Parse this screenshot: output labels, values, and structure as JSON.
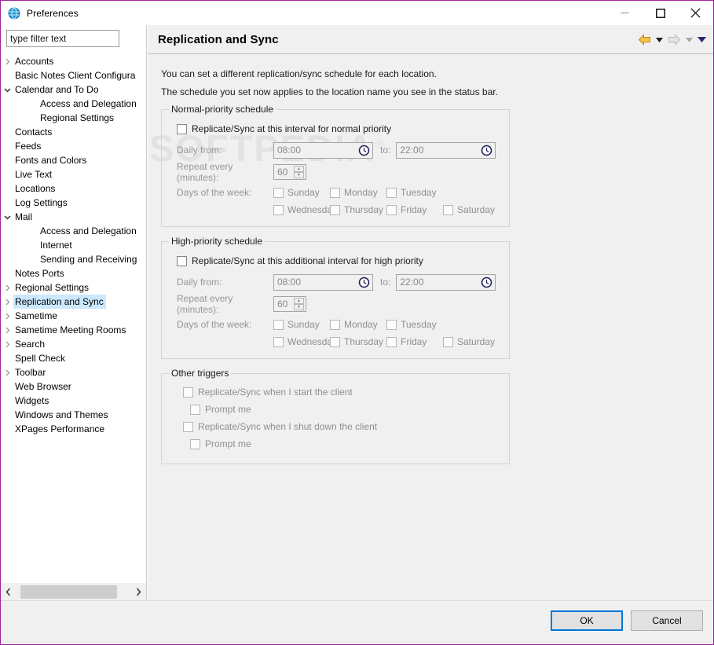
{
  "window": {
    "title": "Preferences",
    "icon": "notes-globe-icon",
    "border_color": "#a0249a",
    "minimize_label": "Minimize",
    "maximize_label": "Maximize",
    "close_label": "Close"
  },
  "watermark": {
    "text": "SOFTPEDIA",
    "mark": "®"
  },
  "sidebar": {
    "filter": {
      "value": "type filter text",
      "placeholder": "type filter text"
    },
    "items": [
      {
        "label": "Accounts",
        "level": 0,
        "arrow": "collapsed",
        "selected": false
      },
      {
        "label": "Basic Notes Client Configura",
        "level": 0,
        "arrow": "none",
        "selected": false
      },
      {
        "label": "Calendar and To Do",
        "level": 0,
        "arrow": "expanded",
        "selected": false
      },
      {
        "label": "Access and Delegation",
        "level": 1,
        "arrow": "none",
        "selected": false
      },
      {
        "label": "Regional Settings",
        "level": 1,
        "arrow": "none",
        "selected": false
      },
      {
        "label": "Contacts",
        "level": 0,
        "arrow": "none",
        "selected": false
      },
      {
        "label": "Feeds",
        "level": 0,
        "arrow": "none",
        "selected": false
      },
      {
        "label": "Fonts and Colors",
        "level": 0,
        "arrow": "none",
        "selected": false
      },
      {
        "label": "Live Text",
        "level": 0,
        "arrow": "none",
        "selected": false
      },
      {
        "label": "Locations",
        "level": 0,
        "arrow": "none",
        "selected": false
      },
      {
        "label": "Log Settings",
        "level": 0,
        "arrow": "none",
        "selected": false
      },
      {
        "label": "Mail",
        "level": 0,
        "arrow": "expanded",
        "selected": false
      },
      {
        "label": "Access and Delegation",
        "level": 1,
        "arrow": "none",
        "selected": false
      },
      {
        "label": "Internet",
        "level": 1,
        "arrow": "none",
        "selected": false
      },
      {
        "label": "Sending and Receiving",
        "level": 1,
        "arrow": "none",
        "selected": false
      },
      {
        "label": "Notes Ports",
        "level": 0,
        "arrow": "none",
        "selected": false
      },
      {
        "label": "Regional Settings",
        "level": 0,
        "arrow": "collapsed",
        "selected": false
      },
      {
        "label": "Replication and Sync",
        "level": 0,
        "arrow": "collapsed",
        "selected": true
      },
      {
        "label": "Sametime",
        "level": 0,
        "arrow": "collapsed",
        "selected": false
      },
      {
        "label": "Sametime Meeting Rooms",
        "level": 0,
        "arrow": "collapsed",
        "selected": false
      },
      {
        "label": "Search",
        "level": 0,
        "arrow": "collapsed",
        "selected": false
      },
      {
        "label": "Spell Check",
        "level": 0,
        "arrow": "none",
        "selected": false
      },
      {
        "label": "Toolbar",
        "level": 0,
        "arrow": "collapsed",
        "selected": false
      },
      {
        "label": "Web Browser",
        "level": 0,
        "arrow": "none",
        "selected": false
      },
      {
        "label": "Widgets",
        "level": 0,
        "arrow": "none",
        "selected": false
      },
      {
        "label": "Windows and Themes",
        "level": 0,
        "arrow": "none",
        "selected": false
      },
      {
        "label": "XPages Performance",
        "level": 0,
        "arrow": "none",
        "selected": false
      }
    ],
    "hscroll": {
      "left_label": "‹",
      "right_label": "›"
    }
  },
  "page": {
    "title": "Replication and Sync",
    "nav": {
      "back": "back-arrow",
      "back_menu": "back-dropdown",
      "forward": "forward-arrow",
      "forward_menu": "forward-dropdown",
      "menu": "view-menu"
    },
    "intro": [
      "You can set a different replication/sync schedule for each location.",
      "The schedule you set now applies to the location name you see in the status bar."
    ],
    "normal_group": {
      "legend": "Normal-priority schedule",
      "enable_label": "Replicate/Sync at this interval for normal priority",
      "enabled": false,
      "daily_from_label": "Daily from:",
      "daily_from_value": "08:00",
      "to_label": "to:",
      "daily_to_value": "22:00",
      "repeat_label": "Repeat every (minutes):",
      "repeat_value": "60",
      "days_label": "Days of the week:",
      "days": [
        {
          "label": "Sunday",
          "checked": false
        },
        {
          "label": "Monday",
          "checked": false
        },
        {
          "label": "Tuesday",
          "checked": false
        },
        {
          "label": "Wednesday",
          "checked": false
        },
        {
          "label": "Thursday",
          "checked": false
        },
        {
          "label": "Friday",
          "checked": false
        },
        {
          "label": "Saturday",
          "checked": false
        }
      ]
    },
    "high_group": {
      "legend": "High-priority schedule",
      "enable_label": "Replicate/Sync at this additional interval for high priority",
      "enabled": false,
      "daily_from_label": "Daily from:",
      "daily_from_value": "08:00",
      "to_label": "to:",
      "daily_to_value": "22:00",
      "repeat_label": "Repeat every (minutes):",
      "repeat_value": "60",
      "days_label": "Days of the week:",
      "days": [
        {
          "label": "Sunday",
          "checked": false
        },
        {
          "label": "Monday",
          "checked": false
        },
        {
          "label": "Tuesday",
          "checked": false
        },
        {
          "label": "Wednesday",
          "checked": false
        },
        {
          "label": "Thursday",
          "checked": false
        },
        {
          "label": "Friday",
          "checked": false
        },
        {
          "label": "Saturday",
          "checked": false
        }
      ]
    },
    "other_group": {
      "legend": "Other triggers",
      "triggers": [
        {
          "label": "Replicate/Sync when I start the client",
          "checked": false,
          "indent": false
        },
        {
          "label": "Prompt me",
          "checked": false,
          "indent": true
        },
        {
          "label": "Replicate/Sync when I shut down the client",
          "checked": false,
          "indent": false
        },
        {
          "label": "Prompt me",
          "checked": false,
          "indent": true
        }
      ]
    }
  },
  "footer": {
    "ok_label": "OK",
    "cancel_label": "Cancel"
  },
  "colors": {
    "window_border": "#a0249a",
    "selection": "#cce8ff",
    "default_button_border": "#0078d7",
    "panel_bg": "#f0f0f0",
    "back_arrow": "#e8a82c",
    "forward_arrow": "#cfcfcf",
    "menu_caret": "#2a2a66"
  }
}
